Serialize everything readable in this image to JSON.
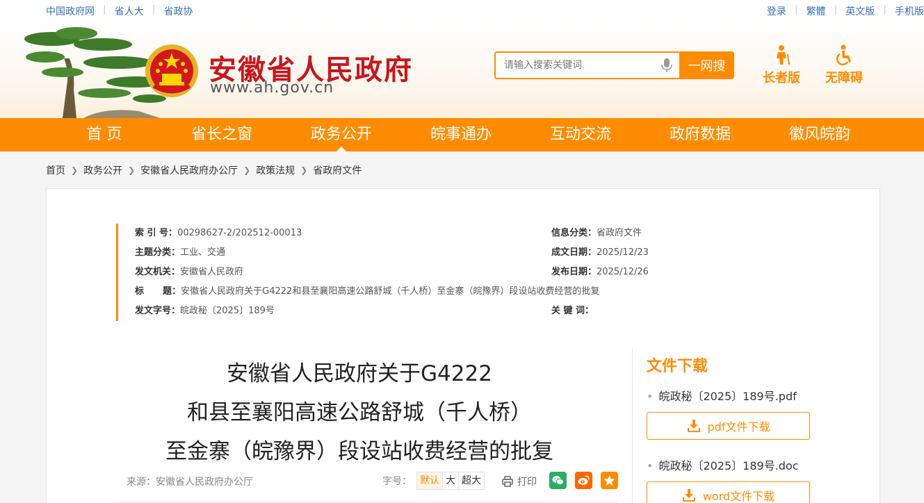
{
  "topbar": {
    "left_links": [
      "中国政府网",
      "省人大",
      "省政协"
    ],
    "right_links": [
      "登录",
      "繁體",
      "英文版",
      "手机版"
    ]
  },
  "header": {
    "site_name": "安徽省人民政府",
    "site_url": "www.ah.gov.cn",
    "search_placeholder": "请输入搜索关键词",
    "search_button": "一网搜",
    "elder_label": "长者版",
    "accessible_label": "无障碍"
  },
  "nav": {
    "items": [
      "首  页",
      "省长之窗",
      "政务公开",
      "皖事通办",
      "互动交流",
      "政府数据",
      "徽风皖韵"
    ],
    "active_index": 2
  },
  "breadcrumb": [
    "首页",
    "政务公开",
    "安徽省人民政府办公厅",
    "政策法规",
    "省政府文件"
  ],
  "meta": {
    "index_key": "索 引 号：",
    "index_value": "00298627-2/202512-00013",
    "topic_key": "主题分类：",
    "topic_value": "工业、交通",
    "issuer_key": "发文机关：",
    "issuer_value": "安徽省人民政府",
    "title_key": "标      题：",
    "title_value": "安徽省人民政府关于G4222和县至襄阳高速公路舒城（千人桥）至金寨（皖豫界）段设站收费经营的批复",
    "docno_key": "发文字号：",
    "docno_value": "皖政秘〔2025〕189号",
    "category_key": "信息分类：",
    "category_value": "省政府文件",
    "created_key": "成文日期：",
    "created_value": "2025/12/23",
    "published_key": "发布日期：",
    "published_value": "2025/12/26",
    "keywords_key": "关 键 词：",
    "keywords_value": ""
  },
  "document": {
    "title_lines": [
      "安徽省人民政府关于G4222",
      "和县至襄阳高速公路舒城（千人桥）",
      "至金寨（皖豫界）段设站收费经营的批复"
    ],
    "source": "来源：安徽省人民政府办公厅",
    "font_size_label": "字号：",
    "font_sizes": [
      "默认",
      "大",
      "超大"
    ],
    "print_label": "打印"
  },
  "downloads": {
    "title": "文件下载",
    "files": [
      {
        "name": "皖政秘〔2025〕189号.pdf",
        "button": "pdf文件下载"
      },
      {
        "name": "皖政秘〔2025〕189号.doc",
        "button": "word文件下载"
      }
    ]
  },
  "colors": {
    "accent": "#ff8c00",
    "brand_red": "#c8161d",
    "link_blue": "#3a6fb5"
  }
}
